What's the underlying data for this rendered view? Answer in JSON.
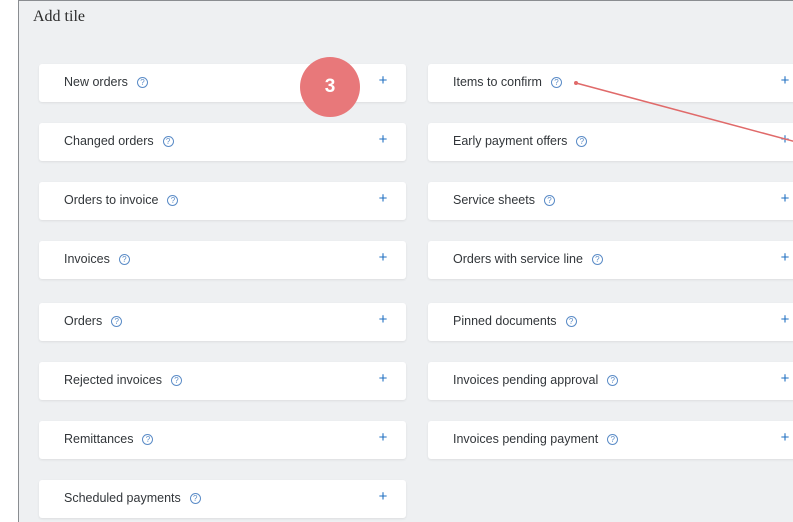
{
  "panel": {
    "title": "Add tile"
  },
  "step_badge": "3",
  "tiles_left": [
    {
      "label": "New orders"
    },
    {
      "label": "Changed orders"
    },
    {
      "label": "Orders to invoice"
    },
    {
      "label": "Invoices"
    },
    {
      "label": "Orders"
    },
    {
      "label": "Rejected invoices"
    },
    {
      "label": "Remittances"
    },
    {
      "label": "Scheduled payments"
    }
  ],
  "tiles_right": [
    {
      "label": "Items to confirm"
    },
    {
      "label": "Early payment offers"
    },
    {
      "label": "Service sheets"
    },
    {
      "label": "Orders with service line"
    },
    {
      "label": "Pinned documents"
    },
    {
      "label": "Invoices pending approval"
    },
    {
      "label": "Invoices pending payment"
    }
  ],
  "icons": {
    "help": "help-circle-icon",
    "add": "plus-icon"
  },
  "colors": {
    "accent": "#1f6fc1",
    "badge": "#e8787a",
    "annotation_line": "#e06a6a",
    "panel_bg": "#eef0f2"
  }
}
